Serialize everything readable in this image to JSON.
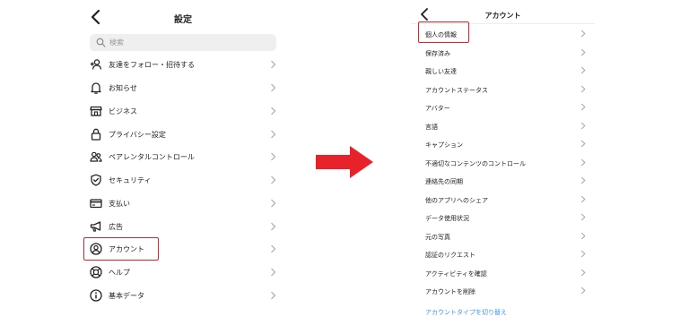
{
  "left_screen": {
    "title": "設定",
    "search_placeholder": "検索",
    "items": [
      {
        "label": "友達をフォロー・招待する",
        "icon": "add-person-icon"
      },
      {
        "label": "お知らせ",
        "icon": "bell-icon"
      },
      {
        "label": "ビジネス",
        "icon": "shop-icon"
      },
      {
        "label": "プライバシー設定",
        "icon": "lock-icon"
      },
      {
        "label": "ペアレンタルコントロール",
        "icon": "people-icon"
      },
      {
        "label": "セキュリティ",
        "icon": "shield-icon"
      },
      {
        "label": "支払い",
        "icon": "credit-card-icon"
      },
      {
        "label": "広告",
        "icon": "megaphone-icon"
      },
      {
        "label": "アカウント",
        "icon": "account-circle-icon"
      },
      {
        "label": "ヘルプ",
        "icon": "lifebuoy-icon"
      },
      {
        "label": "基本データ",
        "icon": "info-icon"
      }
    ]
  },
  "right_screen": {
    "title": "アカウント",
    "items": [
      "個人の情報",
      "保存済み",
      "親しい友達",
      "アカウントステータス",
      "アバター",
      "言語",
      "キャプション",
      "不適切なコンテンツのコントロール",
      "連絡先の同期",
      "他のアプリへのシェア",
      "データ使用状況",
      "元の写真",
      "認証のリクエスト",
      "アクティビティを確認",
      "アカウントを削除"
    ],
    "link": "アカウントタイプを切り替え"
  },
  "colors": {
    "highlight": "#e2222b",
    "arrow": "#e8222a",
    "link": "#3897f0",
    "search_bg": "#efefef"
  }
}
